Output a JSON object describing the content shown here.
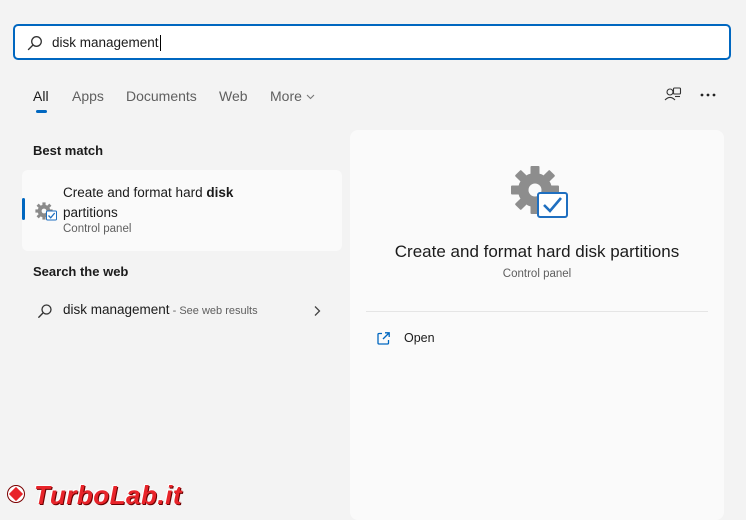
{
  "search": {
    "value": "disk management"
  },
  "tabs": [
    {
      "label": "All",
      "active": true
    },
    {
      "label": "Apps"
    },
    {
      "label": "Documents"
    },
    {
      "label": "Web"
    },
    {
      "label": "More"
    }
  ],
  "toolbar": {
    "icons": [
      "switch-account-icon",
      "more-options-icon"
    ]
  },
  "best_match": {
    "heading": "Best match",
    "title_prefix": "Create and format hard ",
    "title_bold": "disk",
    "title_suffix": "partitions",
    "subtitle": "Control panel"
  },
  "web_search": {
    "heading": "Search the web",
    "query": "disk management",
    "hint": " - See web results"
  },
  "detail": {
    "title": "Create and format hard disk partitions",
    "subtitle": "Control panel",
    "actions": [
      {
        "label": "Open",
        "icon": "open-external-icon"
      }
    ]
  },
  "watermark": {
    "text": "TurboLab.it"
  },
  "colors": {
    "accent": "#0067c0",
    "background": "#f3f3f3",
    "panel": "#fafafa",
    "watermark": "#e8242a"
  }
}
